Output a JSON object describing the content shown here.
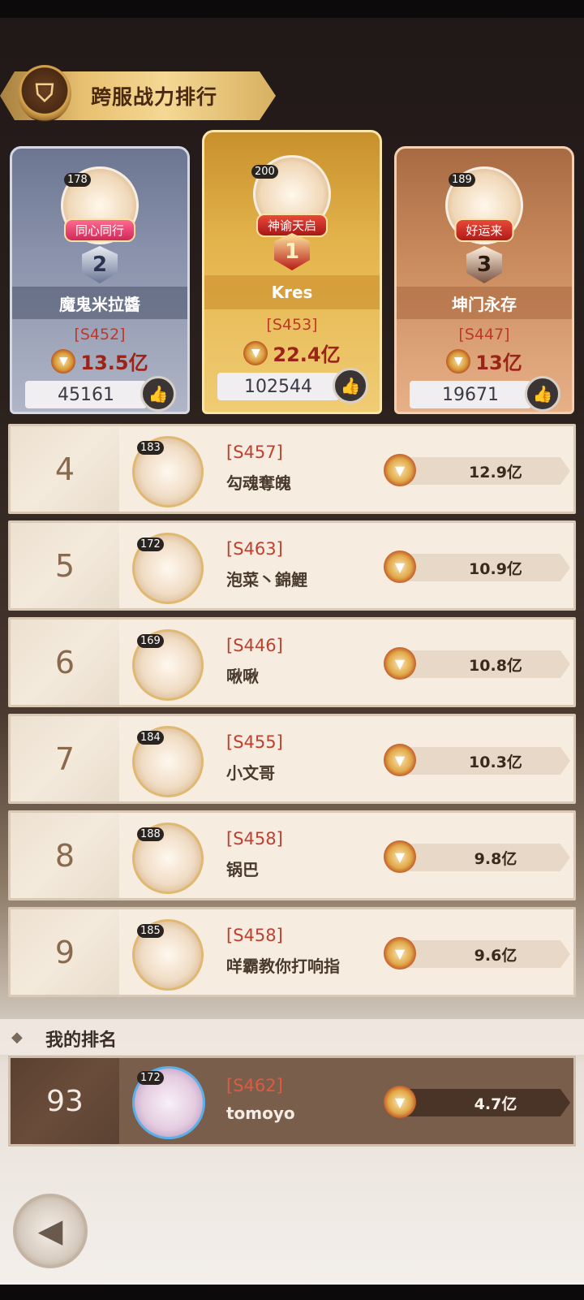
{
  "title": "跨服战力排行",
  "top3": [
    {
      "rank": "2",
      "level": "178",
      "tag": "同心同行",
      "name": "魔鬼米拉醬",
      "server": "[S452]",
      "power": "13.5亿",
      "likes": "45161"
    },
    {
      "rank": "1",
      "level": "200",
      "tag": "神谕天启",
      "name": "Kres",
      "server": "[S453]",
      "power": "22.4亿",
      "likes": "102544"
    },
    {
      "rank": "3",
      "level": "189",
      "tag": "好运来",
      "name": "坤门永存",
      "server": "[S447]",
      "power": "13亿",
      "likes": "19671"
    }
  ],
  "rows": [
    {
      "rank": "4",
      "level": "183",
      "server": "[S457]",
      "name": "勾魂奪魄",
      "power": "12.9亿"
    },
    {
      "rank": "5",
      "level": "172",
      "server": "[S463]",
      "name": "泡菜丶錦鯉",
      "power": "10.9亿"
    },
    {
      "rank": "6",
      "level": "169",
      "server": "[S446]",
      "name": "啾啾",
      "power": "10.8亿"
    },
    {
      "rank": "7",
      "level": "184",
      "server": "[S455]",
      "name": "小文哥",
      "power": "10.3亿"
    },
    {
      "rank": "8",
      "level": "188",
      "server": "[S458]",
      "name": "锅巴",
      "power": "9.8亿"
    },
    {
      "rank": "9",
      "level": "185",
      "server": "[S458]",
      "name": "咩霸教你打响指",
      "power": "9.6亿"
    }
  ],
  "my_rank": {
    "label": "我的排名",
    "rank": "93",
    "level": "172",
    "server": "[S462]",
    "name": "tomoyo",
    "power": "4.7亿"
  }
}
